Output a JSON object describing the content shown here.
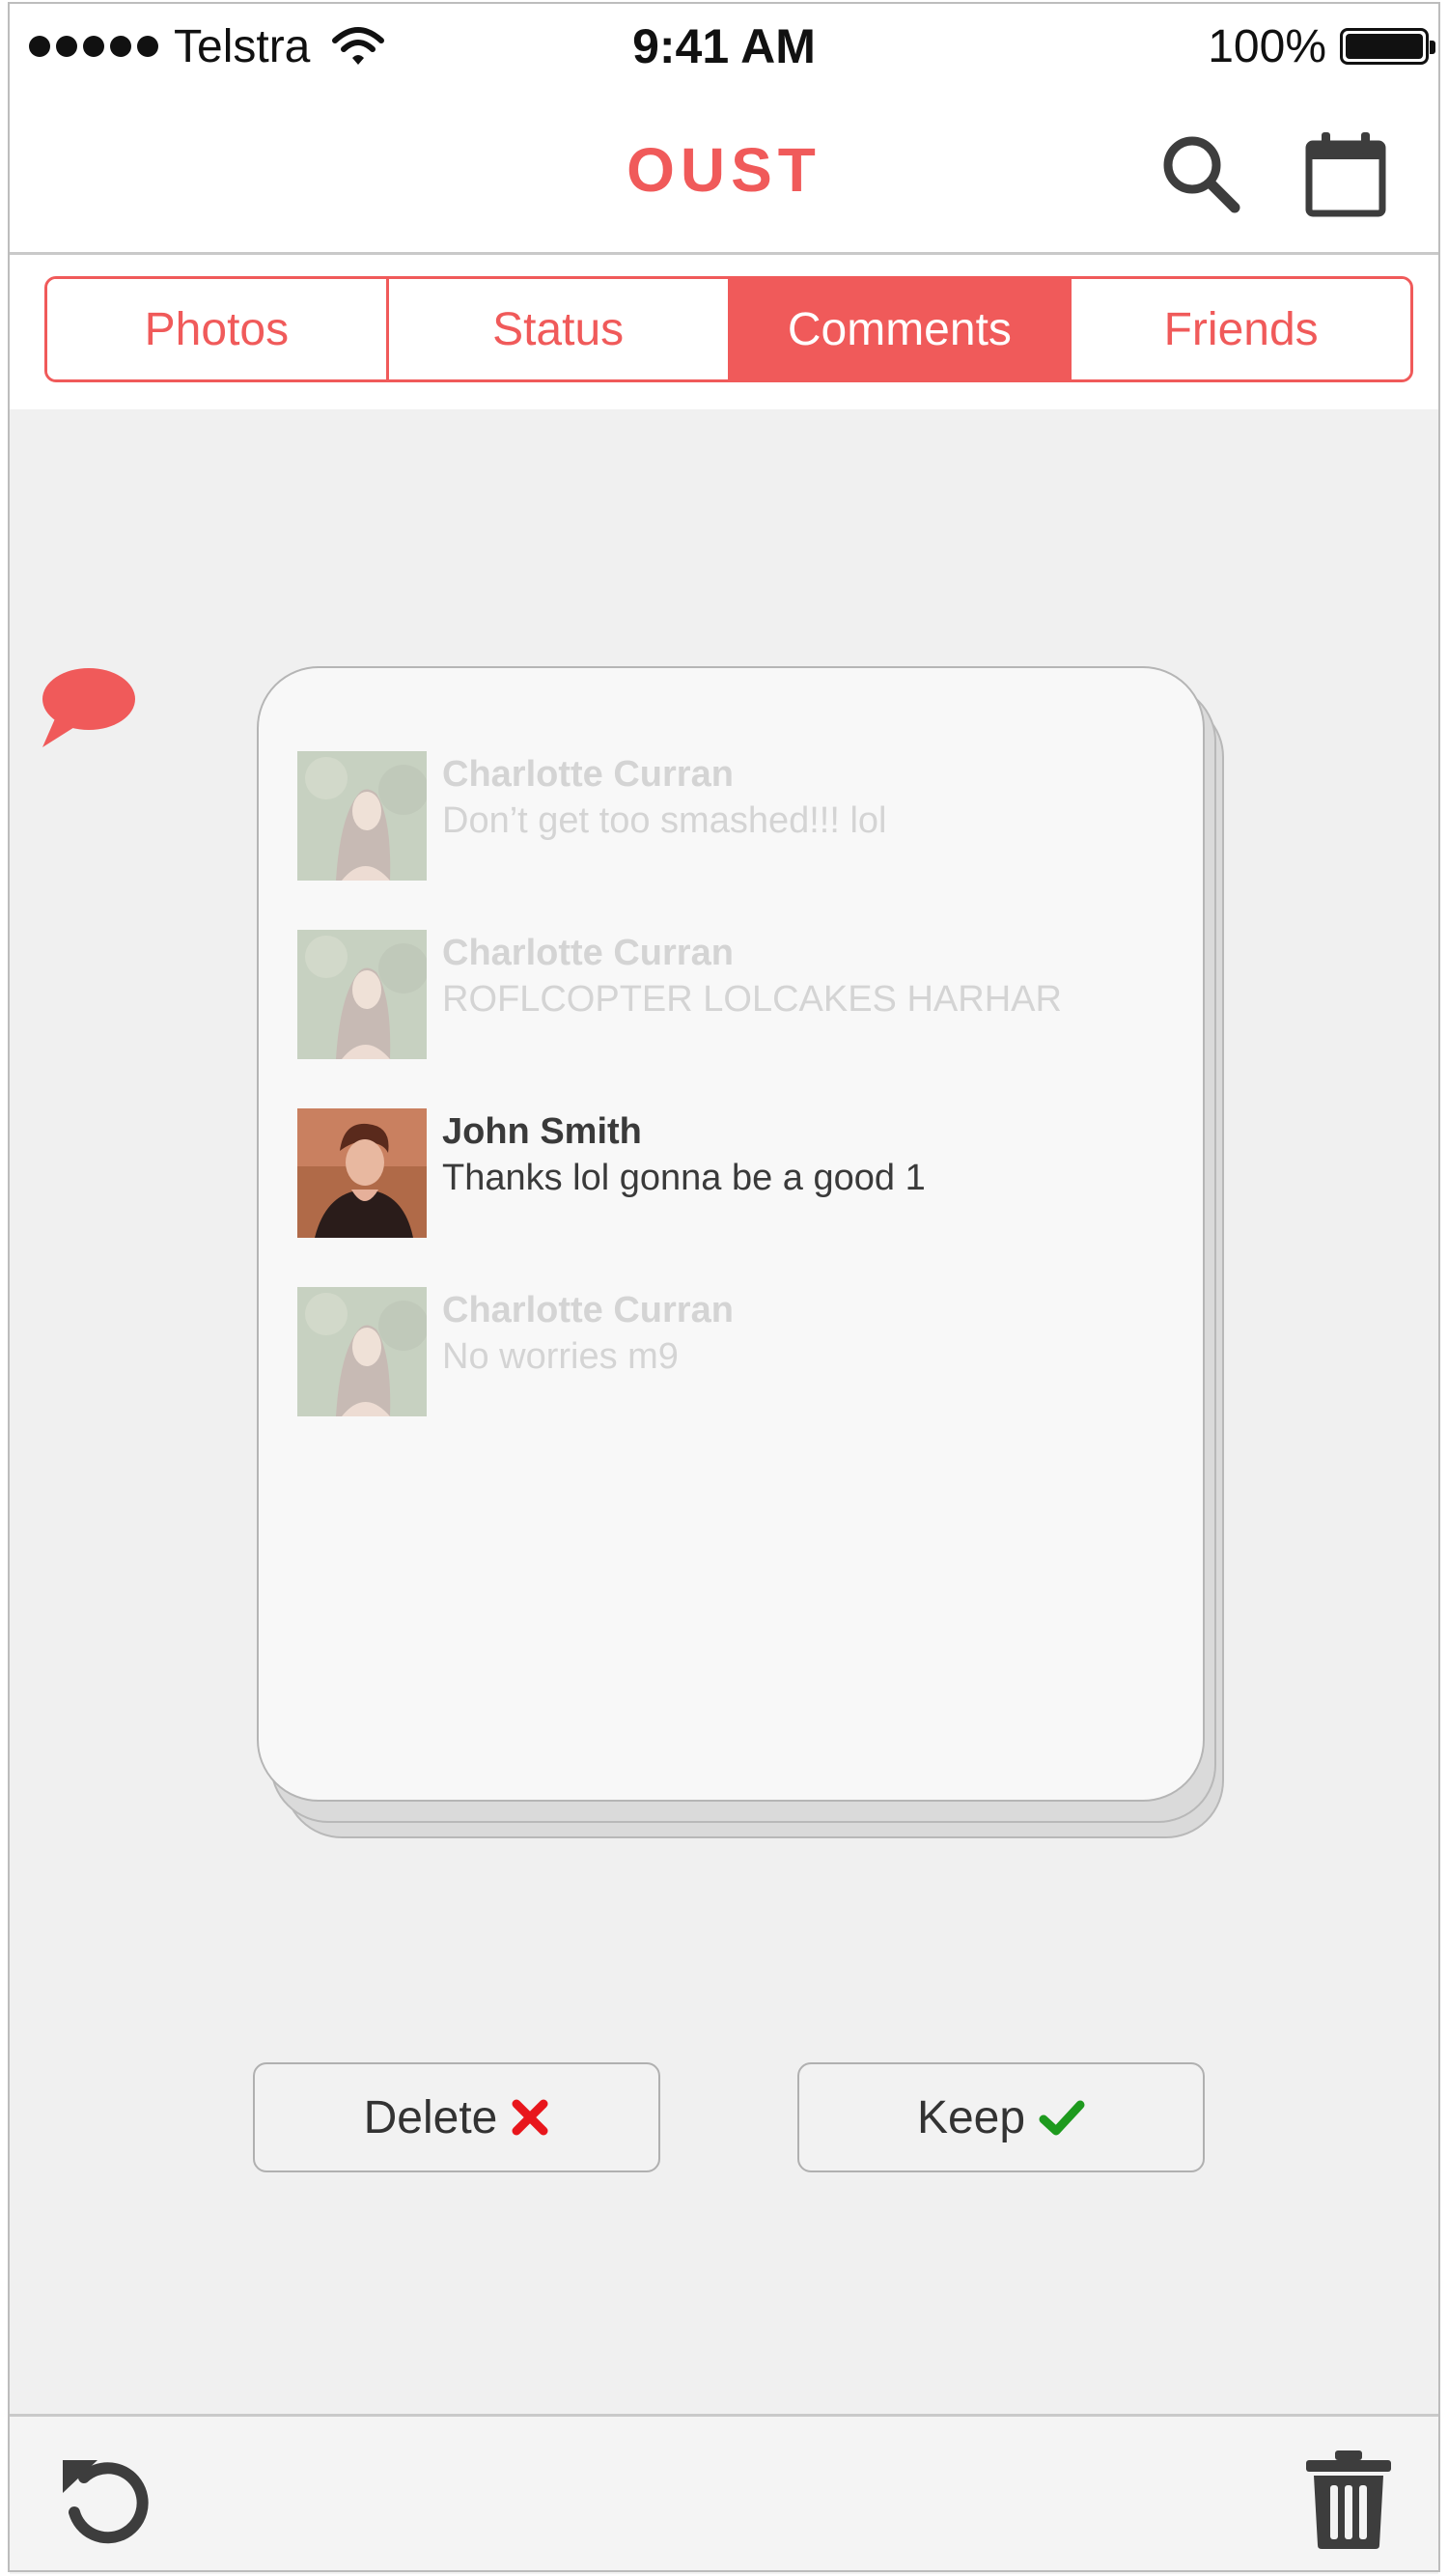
{
  "status_bar": {
    "carrier": "Telstra",
    "time": "9:41 AM",
    "battery": "100%",
    "signal_dots": 5
  },
  "header": {
    "title": "OUST",
    "search_icon": "search-icon",
    "calendar_icon": "calendar-icon"
  },
  "tabs": [
    {
      "label": "Photos",
      "active": false
    },
    {
      "label": "Status",
      "active": false
    },
    {
      "label": "Comments",
      "active": true
    },
    {
      "label": "Friends",
      "active": false
    }
  ],
  "section_icon": "speech-bubble-icon",
  "comments": [
    {
      "name": "Charlotte Curran",
      "message": "Don’t get too smashed!!! lol",
      "active": false
    },
    {
      "name": "Charlotte Curran",
      "message": "ROFLCOPTER LOLCAKES HARHAR",
      "active": false
    },
    {
      "name": "John Smith",
      "message": "Thanks lol gonna be a good 1",
      "active": true
    },
    {
      "name": "Charlotte Curran",
      "message": "No worries m9",
      "active": false
    }
  ],
  "actions": {
    "delete_label": "Delete",
    "keep_label": "Keep"
  },
  "toolbar": {
    "undo_icon": "undo-icon",
    "trash_icon": "trash-icon"
  },
  "colors": {
    "accent": "#f05a5a",
    "delete": "#e8161c",
    "keep": "#1e9a1e",
    "icon_dark": "#3d3d3d"
  }
}
